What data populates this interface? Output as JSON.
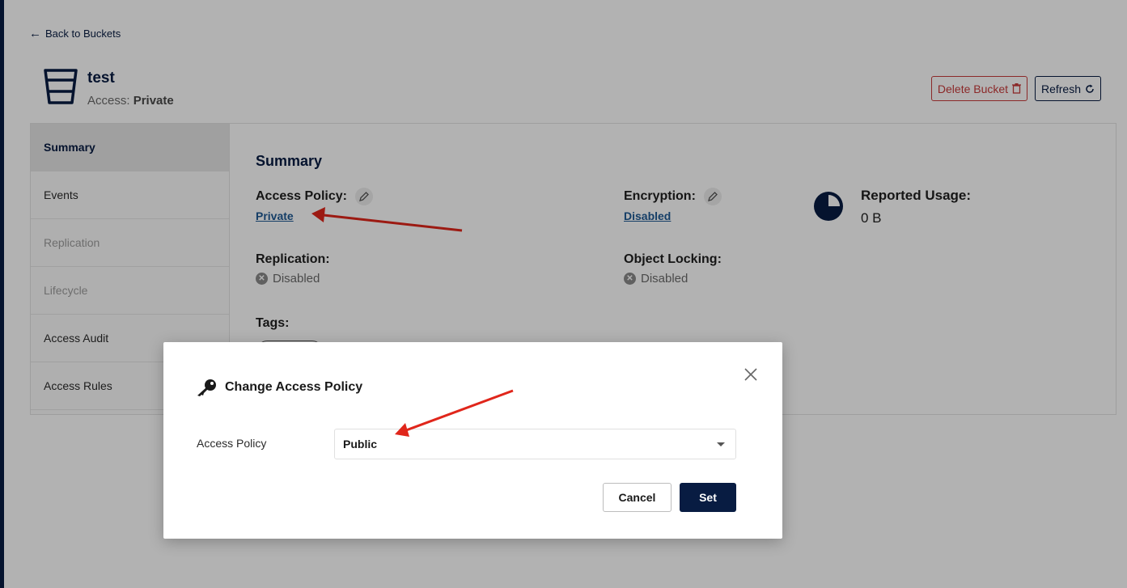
{
  "back_link": "Back to Buckets",
  "bucket": {
    "name": "test",
    "access_label": "Access:",
    "access_value": "Private"
  },
  "header_buttons": {
    "delete": "Delete Bucket",
    "refresh": "Refresh"
  },
  "sidebar": {
    "items": [
      {
        "label": "Summary",
        "state": "active"
      },
      {
        "label": "Events",
        "state": "normal"
      },
      {
        "label": "Replication",
        "state": "disabled"
      },
      {
        "label": "Lifecycle",
        "state": "disabled"
      },
      {
        "label": "Access Audit",
        "state": "normal"
      },
      {
        "label": "Access Rules",
        "state": "normal"
      }
    ]
  },
  "summary": {
    "title": "Summary",
    "access_policy_label": "Access Policy:",
    "access_policy_value": "Private",
    "encryption_label": "Encryption:",
    "encryption_value": "Disabled",
    "reported_usage_label": "Reported Usage:",
    "reported_usage_value": "0 B",
    "replication_label": "Replication:",
    "replication_value": "Disabled",
    "object_locking_label": "Object Locking:",
    "object_locking_value": "Disabled",
    "tags_label": "Tags:"
  },
  "modal": {
    "title": "Change Access Policy",
    "field_label": "Access Policy",
    "selected_value": "Public",
    "cancel_label": "Cancel",
    "set_label": "Set"
  },
  "colors": {
    "brand": "#081c42",
    "danger": "#c83b3b",
    "link": "#1f5a94",
    "annotation_arrow": "#e0261b"
  },
  "icons": [
    "back-arrow-icon",
    "bucket-icon",
    "trash-icon",
    "refresh-icon",
    "pencil-icon",
    "x-circle-icon",
    "pie-usage-icon",
    "key-icon",
    "close-icon",
    "chevron-down-icon"
  ]
}
